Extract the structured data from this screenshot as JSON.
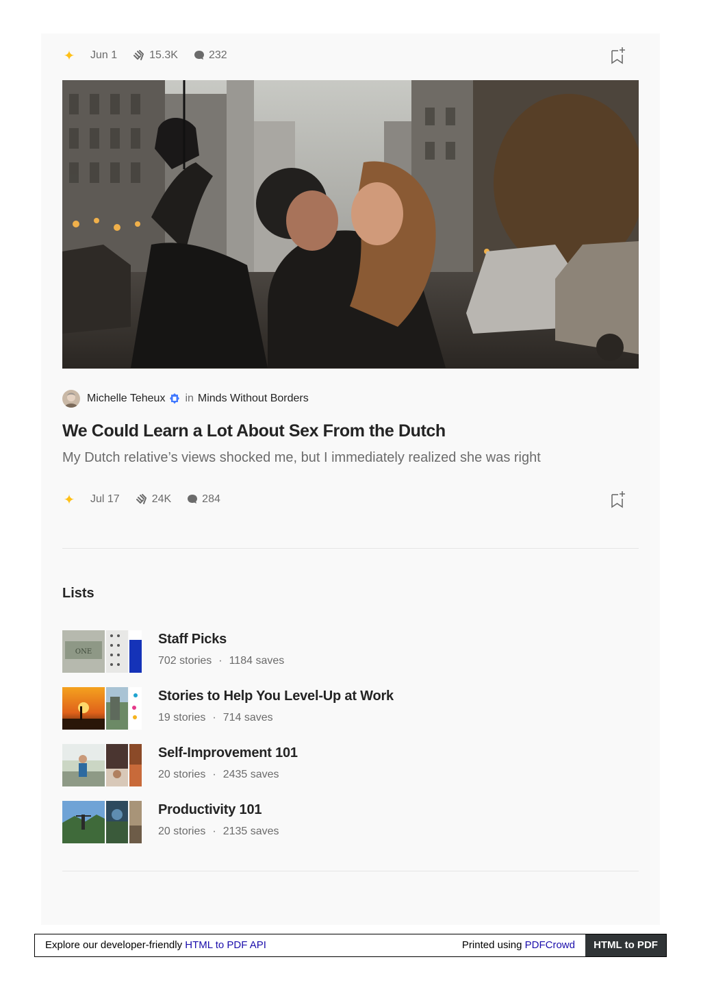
{
  "top_meta": {
    "date": "Jun 1",
    "claps": "15.3K",
    "responses": "232"
  },
  "article": {
    "author": "Michelle Teheux",
    "in_word": "in",
    "publication": "Minds Without Borders",
    "title": "We Could Learn a Lot About Sex From the Dutch",
    "subtitle": "My Dutch relative’s views shocked me, but I immediately realized she was right",
    "date": "Jul 17",
    "claps": "24K",
    "responses": "284"
  },
  "lists": {
    "heading": "Lists",
    "items": [
      {
        "title": "Staff Picks",
        "stories": "702 stories",
        "saves": "1184 saves"
      },
      {
        "title": "Stories to Help You Level-Up at Work",
        "stories": "19 stories",
        "saves": "714 saves"
      },
      {
        "title": "Self-Improvement 101",
        "stories": "20 stories",
        "saves": "2435 saves"
      },
      {
        "title": "Productivity 101",
        "stories": "20 stories",
        "saves": "2135 saves"
      }
    ],
    "dot": "·"
  },
  "footer": {
    "left_text": "Explore our developer-friendly ",
    "left_link": "HTML to PDF API",
    "right_text": "Printed using ",
    "right_link": "PDFCrowd",
    "button": "HTML to PDF"
  },
  "colors": {
    "accent_star": "#ffc017",
    "text": "#242424",
    "muted": "#6b6b6b",
    "verified_badge": "#437afe"
  },
  "icons": [
    "sparkle-star-icon",
    "clap-icon",
    "comment-bubble-icon",
    "bookmark-add-icon",
    "verified-badge-icon"
  ]
}
